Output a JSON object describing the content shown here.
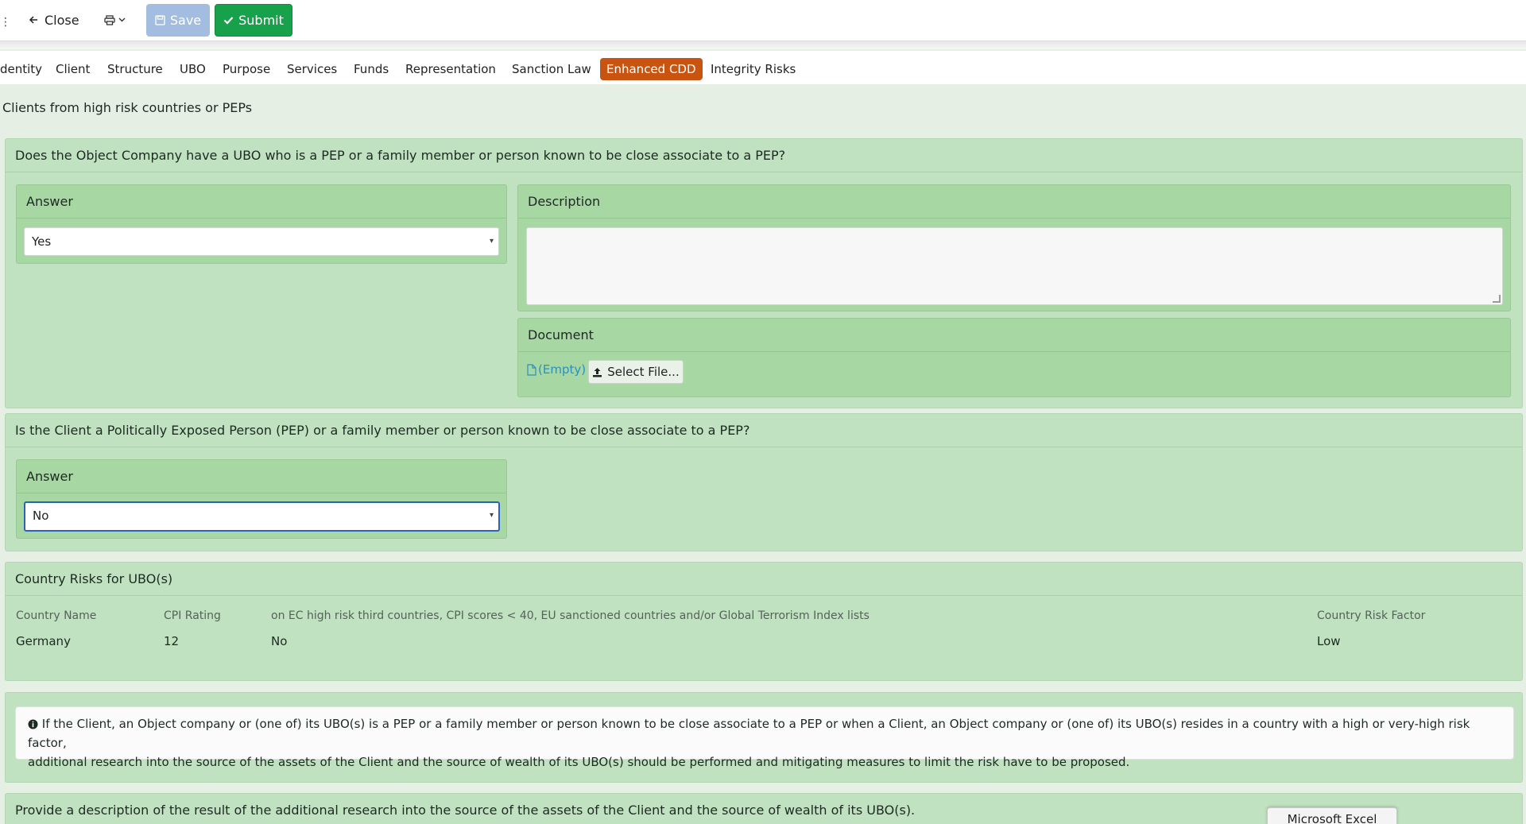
{
  "toolbar": {
    "close_label": "Close",
    "save_label": "Save",
    "submit_label": "Submit"
  },
  "tabs": [
    {
      "label": "dentity"
    },
    {
      "label": "Client"
    },
    {
      "label": "Structure"
    },
    {
      "label": "UBO"
    },
    {
      "label": "Purpose"
    },
    {
      "label": "Services"
    },
    {
      "label": "Funds"
    },
    {
      "label": "Representation"
    },
    {
      "label": "Sanction Law"
    },
    {
      "label": "Enhanced CDD",
      "active": true
    },
    {
      "label": "Integrity Risks"
    }
  ],
  "section_title": "Clients from high risk countries or PEPs",
  "q1": {
    "question": "Does the Object Company have a UBO who is a PEP or a family member or person known to be close associate to a PEP?",
    "answer_label": "Answer",
    "answer_value": "Yes",
    "description_label": "Description",
    "document_label": "Document",
    "file_empty": "(Empty)",
    "select_file": "Select File..."
  },
  "q2": {
    "question": "Is the Client a Politically Exposed Person (PEP) or a family member or person known to be close associate to a PEP?",
    "answer_label": "Answer",
    "answer_value": "No"
  },
  "country_risks": {
    "title": "Country Risks for UBO(s)",
    "columns": [
      "Country Name",
      "CPI Rating",
      "on EC high risk third countries, CPI scores < 40, EU sanctioned countries and/or Global Terrorism Index lists",
      "Country Risk Factor"
    ],
    "rows": [
      [
        "Germany",
        "12",
        "No",
        "Low"
      ]
    ]
  },
  "info": {
    "line1": "If the Client, an Object company or (one of) its UBO(s) is a PEP or a family member or person known to be close associate to a PEP or when a Client, an Object company or (one of) its UBO(s) resides in a country with a high or very-high risk factor,",
    "line2": "additional research into the source of the assets of the Client and the source of wealth of its UBO(s) should be performed and mitigating measures to limit the risk have to be proposed."
  },
  "q3": {
    "question": "Provide a description of the result of the additional research into the source of the assets of the Client and the source of wealth of its UBO(s)."
  },
  "taskbar": {
    "excel_label": "Microsoft Excel"
  },
  "colors": {
    "active_tab": "#c85410",
    "submit": "#17a14a",
    "save_disabled": "#a3bde0",
    "panel": "#c0e2c0",
    "sub_panel": "#a7d7a2",
    "link": "#2b8fc3"
  }
}
